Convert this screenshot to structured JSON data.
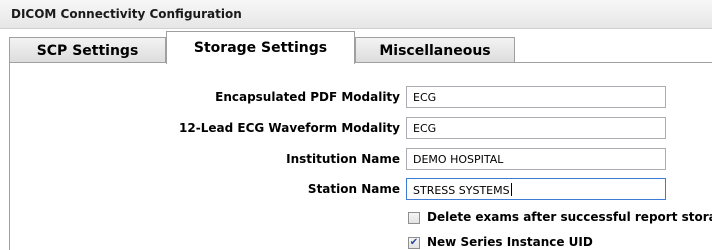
{
  "window": {
    "title": "DICOM Connectivity Configuration"
  },
  "tabs": [
    {
      "label": "SCP Settings",
      "active": false
    },
    {
      "label": "Storage Settings",
      "active": true
    },
    {
      "label": "Miscellaneous",
      "active": false
    }
  ],
  "storage": {
    "fields": [
      {
        "label": "Encapsulated PDF Modality",
        "value": "ECG"
      },
      {
        "label": "12-Lead ECG Waveform Modality",
        "value": "ECG"
      },
      {
        "label": "Institution Name",
        "value": "DEMO HOSPITAL"
      },
      {
        "label": "Station Name",
        "value": "STRESS SYSTEMS"
      }
    ],
    "checkboxes": [
      {
        "label": "Delete exams after successful report storage",
        "checked": false
      },
      {
        "label": "New Series Instance UID",
        "checked": true
      }
    ]
  }
}
